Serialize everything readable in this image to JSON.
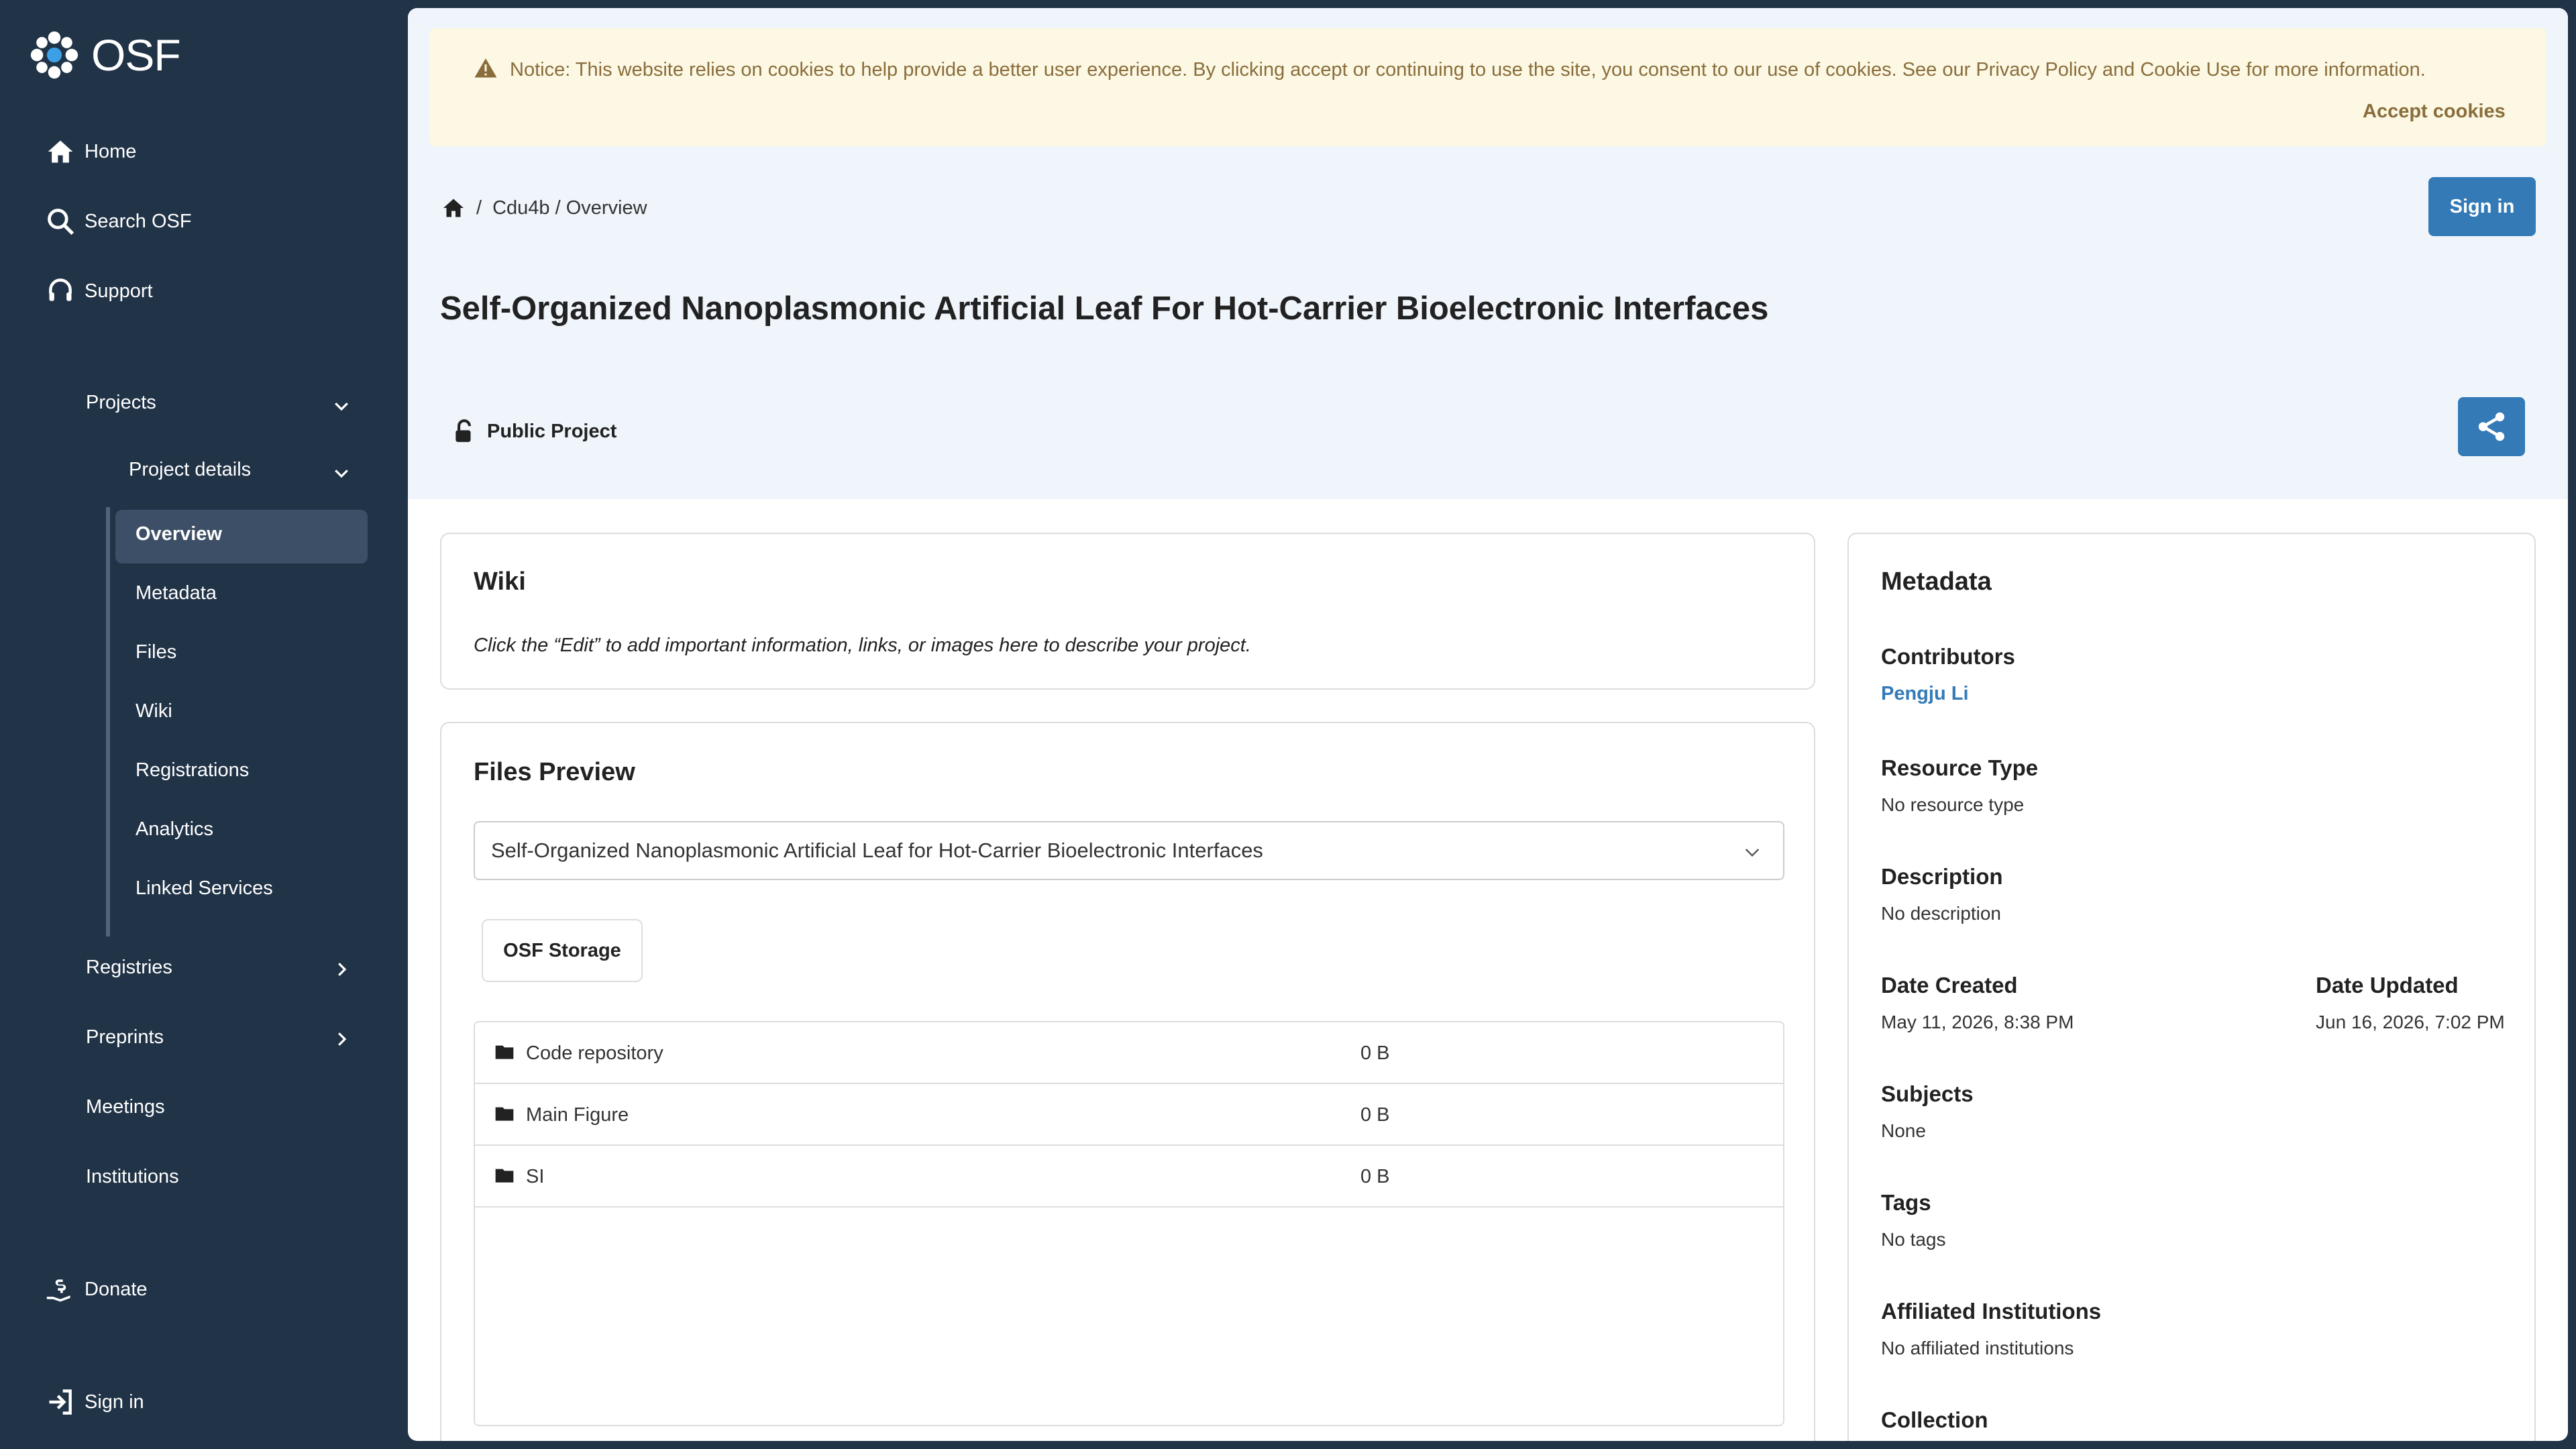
{
  "app": {
    "logo_text": "OSF"
  },
  "sidebar": {
    "home": "Home",
    "search": "Search OSF",
    "support": "Support",
    "projects": "Projects",
    "project_details": "Project details",
    "sub_items": [
      "Overview",
      "Metadata",
      "Files",
      "Wiki",
      "Registrations",
      "Analytics",
      "Linked Services"
    ],
    "registries": "Registries",
    "preprints": "Preprints",
    "meetings": "Meetings",
    "institutions": "Institutions",
    "donate": "Donate",
    "signin": "Sign in"
  },
  "cookie": {
    "notice": "Notice: This website relies on cookies to help provide a better user experience. By clicking accept or continuing to use the site, you consent to our use of cookies. See our Privacy Policy and Cookie Use for more information.",
    "accept": "Accept cookies"
  },
  "header": {
    "breadcrumb_sep": "/",
    "breadcrumb": "Cdu4b / Overview",
    "signin": "Sign in",
    "title": "Self-Organized Nanoplasmonic Artificial Leaf For Hot-Carrier Bioelectronic Interfaces",
    "visibility": "Public Project"
  },
  "wiki": {
    "heading": "Wiki",
    "text": "Click the “Edit” to add important information, links, or images here to describe your project."
  },
  "files": {
    "heading": "Files Preview",
    "selected": "Self-Organized Nanoplasmonic Artificial Leaf for Hot-Carrier Bioelectronic Interfaces",
    "storage": "OSF Storage",
    "rows": [
      {
        "name": "Code repository",
        "size": "0 B"
      },
      {
        "name": "Main Figure",
        "size": "0 B"
      },
      {
        "name": "SI",
        "size": "0 B"
      }
    ]
  },
  "metadata": {
    "heading": "Metadata",
    "contributors_label": "Contributors",
    "contributors_value": "Pengju Li",
    "resource_type_label": "Resource Type",
    "resource_type_value": "No resource type",
    "description_label": "Description",
    "description_value": "No description",
    "date_created_label": "Date Created",
    "date_created_value": "May 11, 2026, 8:38 PM",
    "date_updated_label": "Date Updated",
    "date_updated_value": "Jun 16, 2026, 7:02 PM",
    "subjects_label": "Subjects",
    "subjects_value": "None",
    "tags_label": "Tags",
    "tags_value": "No tags",
    "institutions_label": "Affiliated Institutions",
    "institutions_value": "No affiliated institutions",
    "collection_label": "Collection"
  },
  "colors": {
    "sidebar": "#213347",
    "accent": "#337ab7",
    "hero": "#eff5fb",
    "notice_bg": "#fcf8e4",
    "notice_text": "#8a6d3b"
  }
}
